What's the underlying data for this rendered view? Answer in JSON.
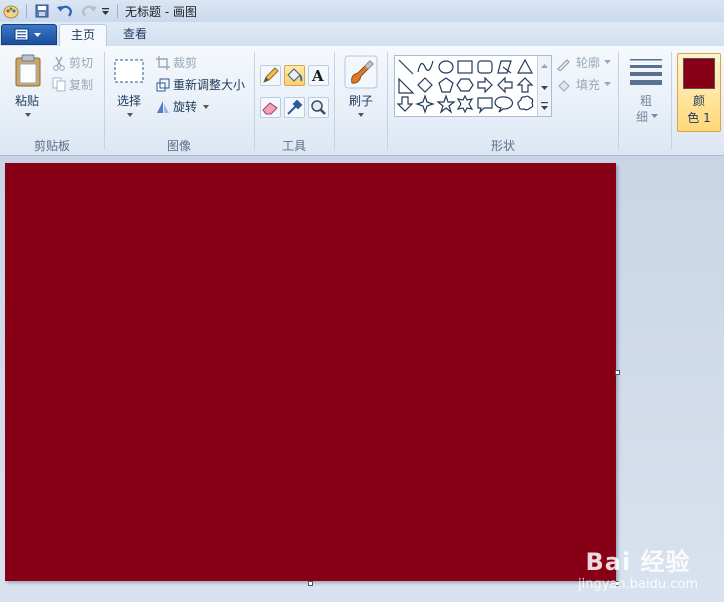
{
  "window": {
    "title": "无标题 - 画图"
  },
  "tabs": [
    {
      "label": "主页",
      "active": true
    },
    {
      "label": "查看",
      "active": false
    }
  ],
  "ribbon": {
    "clipboard": {
      "group_label": "剪贴板",
      "paste_label": "粘贴",
      "cut_label": "剪切",
      "copy_label": "复制"
    },
    "image": {
      "group_label": "图像",
      "select_label": "选择",
      "crop_label": "裁剪",
      "resize_label": "重新调整大小",
      "rotate_label": "旋转"
    },
    "tools": {
      "group_label": "工具",
      "selected_tool": "fill-bucket-icon"
    },
    "brush": {
      "label": "刷子"
    },
    "shapes": {
      "group_label": "形状",
      "outline_label": "轮廓",
      "fill_label": "填充"
    },
    "size": {
      "label_line1": "粗",
      "label_line2": "细"
    },
    "color1": {
      "label_line1": "颜",
      "label_line2": "色 1",
      "value": "#880016"
    }
  },
  "canvas": {
    "fill_color": "#880016"
  },
  "watermark": {
    "top": "Bai 经验",
    "bottom": "jingyan.baidu.com"
  }
}
